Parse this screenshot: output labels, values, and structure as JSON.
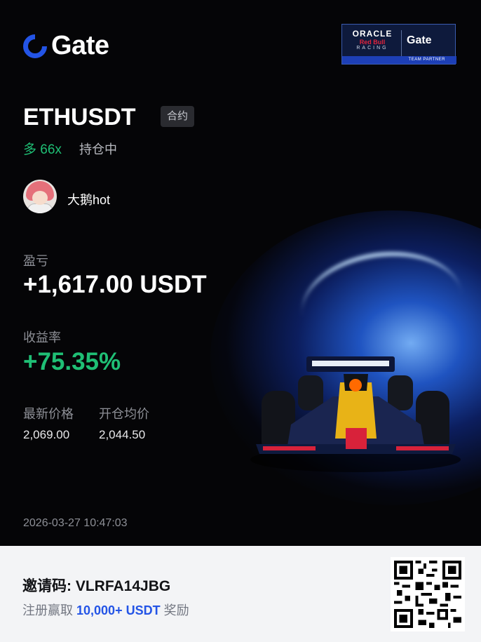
{
  "brand": {
    "name": "Gate"
  },
  "partner_badge": {
    "line1": "ORACLE",
    "line2": "Red Bull",
    "line3": "RACING",
    "gate": "Gate",
    "footer": "TEAM PARTNER"
  },
  "position": {
    "symbol": "ETHUSDT",
    "type_tag": "合约",
    "side": "多 66x",
    "status": "持仓中"
  },
  "user": {
    "name": "大鹅hot"
  },
  "pnl": {
    "label": "盈亏",
    "value": "+1,617.00 USDT"
  },
  "roi": {
    "label": "收益率",
    "value": "+75.35%"
  },
  "prices": {
    "last_label": "最新价格",
    "last_value": "2,069.00",
    "entry_label": "开仓均价",
    "entry_value": "2,044.50"
  },
  "timestamp": "2026-03-27 10:47:03",
  "footer": {
    "invite_label": "邀请码: ",
    "invite_code": "VLRFA14JBG",
    "reward_prefix": "注册赢取 ",
    "reward_amount": "10,000+ USDT",
    "reward_suffix": " 奖励"
  },
  "colors": {
    "accent_blue": "#2354e6",
    "profit_green": "#1fbf75",
    "background": "#050507"
  }
}
